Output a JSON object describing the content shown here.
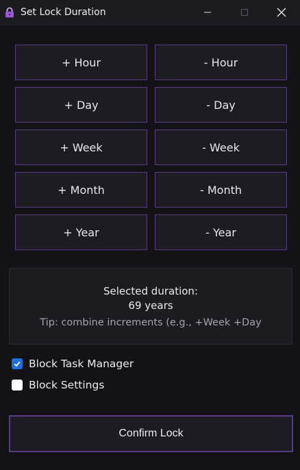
{
  "window": {
    "title": "Set Lock Duration"
  },
  "increments": [
    {
      "add": "+ Hour",
      "sub": "- Hour"
    },
    {
      "add": "+ Day",
      "sub": "- Day"
    },
    {
      "add": "+ Week",
      "sub": "- Week"
    },
    {
      "add": "+ Month",
      "sub": "- Month"
    },
    {
      "add": "+ Year",
      "sub": "- Year"
    }
  ],
  "info": {
    "label": "Selected duration:",
    "value": "69 years",
    "tip": "Tip: combine increments (e.g., +Week +Day"
  },
  "options": {
    "block_task_manager": {
      "label": "Block Task Manager",
      "checked": true
    },
    "block_settings": {
      "label": "Block Settings",
      "checked": false
    }
  },
  "confirm_label": "Confirm Lock",
  "colors": {
    "accent_border": "#5a3c86",
    "checkbox_checked": "#1e6fd9",
    "lock_icon": "#9b59d0"
  }
}
